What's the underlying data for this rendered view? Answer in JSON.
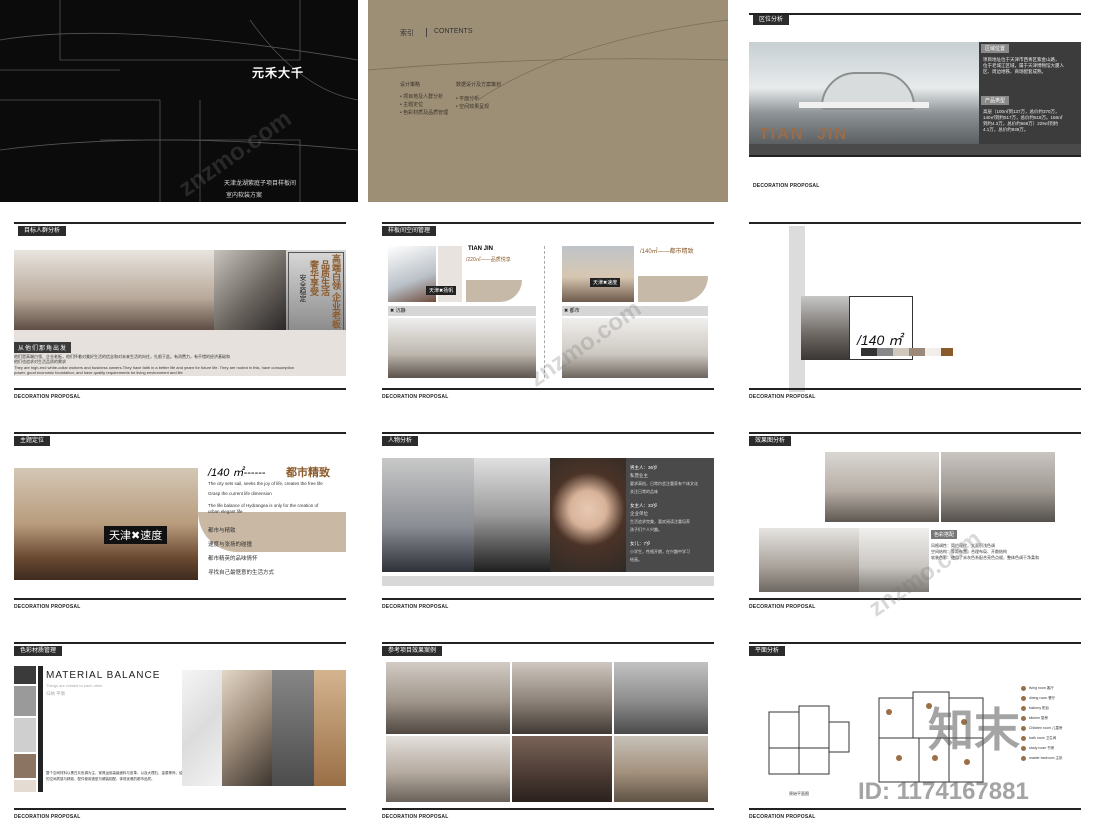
{
  "common": {
    "footer": "DECORATION PROPOSAL"
  },
  "slide1": {
    "logo": "元禾大千",
    "subtitle": "天津龙湖紫庭子项目样板间",
    "subtitle2": "室内软装方案"
  },
  "slide2": {
    "index": "索引",
    "contents": "CONTENTS",
    "col1_title": "设计策略",
    "col1_items": [
      "• 项目地及人群分析",
      "• 主题定位",
      "• 色彩材质及品质管理"
    ],
    "col2_title": "数据设计及方案策划",
    "col2_items": [
      "• 平面分析",
      "• 空间效果呈现"
    ]
  },
  "slide3": {
    "tag": "区位分析",
    "city1": "TIAN",
    "city2": "JIN",
    "box1_title": "区域位置",
    "box1_text": [
      "项目地址位于天津市西青区紫金山路，",
      "位于老城江区域，属于天津博物馆大厦人",
      "区、周边地铁、商场配套成熟。"
    ],
    "box2_title": "产品类型",
    "box2_text": [
      "高层（100㎡到137万，总价约370万，",
      "140㎡到约517万，总价约518万。168㎡",
      "到约4.3万，总价约668万）229㎡到约",
      "4.1万，总价约939万。"
    ]
  },
  "slide4": {
    "tag": "目标人群分析",
    "right_v1": "高端白领 企业老板",
    "right_v2": "品质生活",
    "right_v3": "奢华享受",
    "right_v4": "安全稳定",
    "caption_tag": "从他们那角出发",
    "caption_text": [
      "他们是高端白领、企业老板，他们怀着对美好生活的信念和对未来生活的向往，扎根于此。有消费力，有不错的经济基础和",
      "他们也追求对生活品质的需求"
    ],
    "caption_en": [
      "They are high-end white-collar workers and business owners.They have faith in a better life and yearn for future life. They are rooted in this, have consumption",
      "power, good economic foundation, and have quality requirements for living environment and life"
    ]
  },
  "slide5": {
    "tag": "样板间空间管理",
    "left_title": "TIAN JIN",
    "left_area": "/220㎡——品质悦享",
    "left_badge": "天津✖扬帆",
    "left_label": "✖ 沉静",
    "right_area": "/140㎡——都市精致",
    "right_badge": "天津✖速度",
    "right_label": "✖ 都市"
  },
  "slide6": {
    "area": "/140 ㎡"
  },
  "slide7": {
    "tag": "主题定位",
    "area": "/140 ㎡------",
    "area_title": "都市精致",
    "badge": "天津✖速度",
    "en": [
      "The city sets sail, seeks the joy of life, creates the free life",
      "Grasp the current life dimension",
      "The life balance of Hydrangea is only for the creation of",
      "urban elegant life"
    ],
    "cn": [
      "都市与精致",
      "速度与张扬的碰撞",
      "都市精英的品味情怀",
      "寻找自己最惬意的生活方式"
    ]
  },
  "slide8": {
    "tag": "人物分析",
    "p1": [
      "男主人：36岁",
      "私营业主",
      "要求高档，日常约会注重家有个体文化",
      "关注日常的品味"
    ],
    "p2": [
      "女主人：33岁",
      "企业单位",
      "生活追求完美，喜欢阅读注重培养",
      "孩子们个人兴趣。"
    ],
    "p3": [
      "女儿：7岁",
      "小学生，性格开朗，在兴趣中学习",
      "绘画。"
    ]
  },
  "slide9": {
    "tag": "效果图分析",
    "label": "色彩搭配",
    "text": [
      "风格调性：简约现代，大面积浅色调",
      "空间结构：等距布置，合理布局、开敞结构",
      "软装色彩：使用了米灰色系配合亮色点缀，整体色调干净柔和"
    ]
  },
  "slide10": {
    "tag": "色彩材质管理",
    "title": "MATERIAL BALANCE",
    "sub": "Things are related to each other",
    "sub2": "归纳 平衡",
    "text": [
      "整个空间材料以黑白灰色调为主，家具运用高级面料与皮革，以及大理石、金属等饰，给",
      "的空间质感与精致，配件使用造型与硬装相配，体现优雅的都市品质。"
    ]
  },
  "slide11": {
    "tag": "参考项目效果案例"
  },
  "slide12": {
    "tag": "平面分析",
    "plan_label": "原始平面图",
    "legend": [
      "living room 客厅",
      "dining room 餐厅",
      "balcony 阳台",
      "kitchen 厨房",
      "Children room 儿童房",
      "bath room 卫生间",
      "study room 书房",
      "master bedroom 主卧"
    ]
  },
  "watermark": {
    "site": "znzmo.com",
    "brand": "知末",
    "id": "ID: 1174167881"
  },
  "colors": {
    "accent_brown": "#8a5a2c",
    "tag_dark": "#2c2c2c",
    "khaki": "#9d8f76"
  }
}
